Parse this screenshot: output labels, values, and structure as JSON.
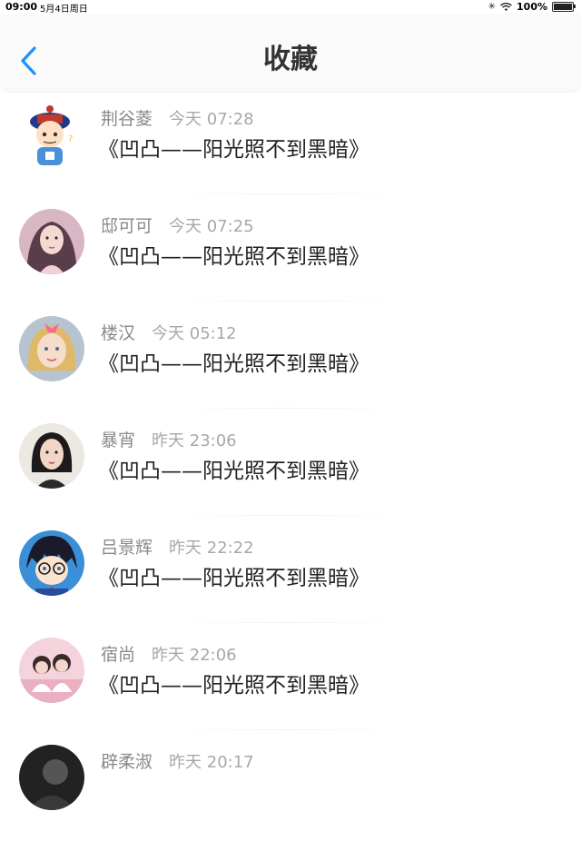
{
  "status_bar": {
    "time": "09:00",
    "date": "5月4日周日",
    "battery": "100%",
    "battery_level": 1.0
  },
  "nav": {
    "title": "收藏",
    "back_icon": "chevron-left-icon",
    "accent": "#1e90ff"
  },
  "items": [
    {
      "name": "荆谷菱",
      "time": "今天 07:28",
      "text": "《凹凸——阳光照不到黑暗》",
      "avatar": "cartoon-qing-official-avatar"
    },
    {
      "name": "邸可可",
      "time": "今天 07:25",
      "text": "《凹凸——阳光照不到黑暗》",
      "avatar": "girl-pink-portrait-avatar"
    },
    {
      "name": "楼汉",
      "time": "今天 05:12",
      "text": "《凹凸——阳光照不到黑暗》",
      "avatar": "child-blonde-bow-avatar"
    },
    {
      "name": "暴宵",
      "time": "昨天 23:06",
      "text": "《凹凸——阳光照不到黑暗》",
      "avatar": "woman-portrait-avatar"
    },
    {
      "name": "吕景辉",
      "time": "昨天 22:22",
      "text": "《凹凸——阳光照不到黑暗》",
      "avatar": "anime-detective-avatar"
    },
    {
      "name": "宿尚",
      "time": "昨天 22:06",
      "text": "《凹凸——阳光照不到黑暗》",
      "avatar": "two-girls-photo-avatar"
    },
    {
      "name": "辟柔淑",
      "time": "昨天 20:17",
      "text": "",
      "avatar": "dark-portrait-avatar"
    }
  ]
}
